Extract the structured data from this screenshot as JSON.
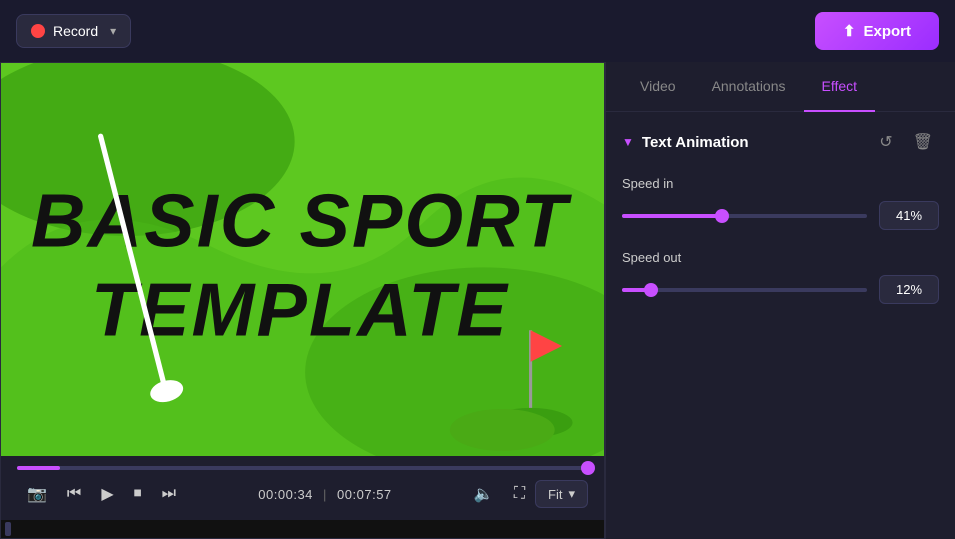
{
  "header": {
    "record_label": "Record",
    "export_label": "Export",
    "export_icon": "⬆"
  },
  "tabs": [
    {
      "id": "video",
      "label": "Video",
      "active": false
    },
    {
      "id": "annotations",
      "label": "Annotations",
      "active": false
    },
    {
      "id": "effect",
      "label": "Effect",
      "active": true
    }
  ],
  "effect_panel": {
    "section_title": "Text Animation",
    "controls": [
      {
        "id": "speed_in",
        "label": "Speed in",
        "value": "41%",
        "slider_pct": 41
      },
      {
        "id": "speed_out",
        "label": "Speed out",
        "value": "12%",
        "slider_pct": 12
      }
    ]
  },
  "video_controls": {
    "current_time": "00:00:34",
    "total_time": "00:07:57",
    "fit_label": "Fit"
  }
}
